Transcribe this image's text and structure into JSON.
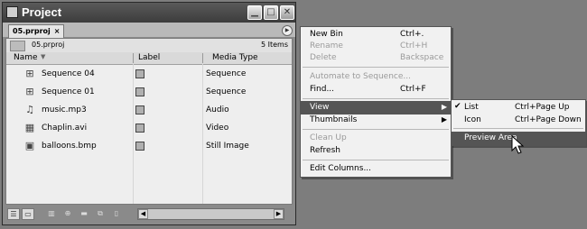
{
  "window": {
    "title": "Project",
    "controls": [
      "minimize",
      "maximize",
      "close"
    ],
    "tab_label": "05.prproj",
    "tab_close": "×"
  },
  "info": {
    "file_name": "05.prproj",
    "item_count": "5 Items"
  },
  "columns": {
    "name": "Name",
    "label": "Label",
    "media_type": "Media Type"
  },
  "items": [
    {
      "icon": "sequence-icon",
      "name": "Sequence 04",
      "media_type": "Sequence"
    },
    {
      "icon": "sequence-icon",
      "name": "Sequence 01",
      "media_type": "Sequence"
    },
    {
      "icon": "speaker-icon",
      "name": "music.mp3",
      "media_type": "Audio"
    },
    {
      "icon": "film-icon",
      "name": "Chaplin.avi",
      "media_type": "Video"
    },
    {
      "icon": "image-icon",
      "name": "balloons.bmp",
      "media_type": "Still Image"
    }
  ],
  "context_menu": {
    "new_bin": {
      "label": "New Bin",
      "shortcut": "Ctrl+."
    },
    "rename": {
      "label": "Rename",
      "shortcut": "Ctrl+H"
    },
    "delete": {
      "label": "Delete",
      "shortcut": "Backspace"
    },
    "automate": {
      "label": "Automate to Sequence..."
    },
    "find": {
      "label": "Find...",
      "shortcut": "Ctrl+F"
    },
    "view": {
      "label": "View"
    },
    "thumbnails": {
      "label": "Thumbnails"
    },
    "clean_up": {
      "label": "Clean Up"
    },
    "refresh": {
      "label": "Refresh"
    },
    "edit_columns": {
      "label": "Edit Columns..."
    }
  },
  "view_submenu": {
    "list": {
      "label": "List",
      "shortcut": "Ctrl+Page Up",
      "checked": true
    },
    "icon": {
      "label": "Icon",
      "shortcut": "Ctrl+Page Down"
    },
    "preview_area": {
      "label": "Preview Area"
    }
  },
  "colors": {
    "highlight": "#555555",
    "label_swatch": "#b0b0b0",
    "titlebar": "#4a4a4a"
  }
}
